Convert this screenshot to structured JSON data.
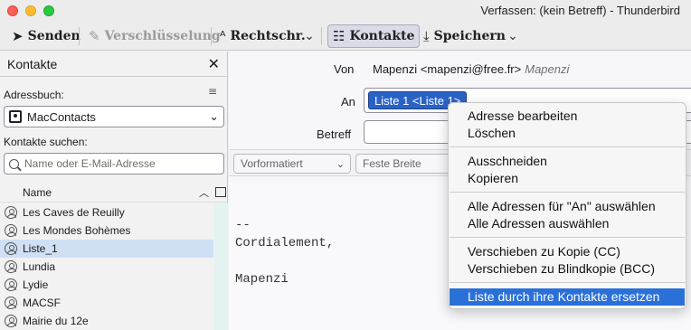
{
  "window": {
    "title": "Verfassen: (kein Betreff) - Thunderbird"
  },
  "toolbar": {
    "send": "Senden",
    "encryption": "Verschlüsselung",
    "spelling": "Rechtschr.",
    "contacts": "Kontakte",
    "save": "Speichern"
  },
  "sidebar": {
    "title": "Kontakte",
    "addressbook_label": "Adressbuch:",
    "addressbook_value": "MacContacts",
    "search_label": "Kontakte suchen:",
    "search_placeholder": "Name oder E-Mail-Adresse",
    "column_name": "Name",
    "contacts": [
      {
        "name": "Les Caves de Reuilly"
      },
      {
        "name": "Les Mondes Bohèmes"
      },
      {
        "name": "Liste_1"
      },
      {
        "name": "Lundia"
      },
      {
        "name": "Lydie"
      },
      {
        "name": "MACSF"
      },
      {
        "name": "Mairie du 12e"
      }
    ]
  },
  "compose": {
    "from_label": "Von",
    "from_value": "Mapenzi <mapenzi@free.fr>",
    "from_identity": "Mapenzi",
    "to_label": "An",
    "to_recipient": "Liste 1 <Liste 1>",
    "subject_label": "Betreff",
    "format_paragraph": "Vorformatiert",
    "format_font": "Feste Breite",
    "signature_lines": [
      "--",
      "Cordialement,",
      "",
      "Mapenzi"
    ]
  },
  "context_menu": {
    "items": [
      "Adresse bearbeiten",
      "Löschen",
      "Ausschneiden",
      "Kopieren",
      "Alle Adressen für \"An\" auswählen",
      "Alle Adressen auswählen",
      "Verschieben zu Kopie (CC)",
      "Verschieben zu Blindkopie (BCC)",
      "Liste durch ihre Kontakte ersetzen"
    ],
    "highlighted_index": 8
  },
  "colors": {
    "accent": "#2a70d9",
    "selection": "#cfe0f5",
    "pill": "#2a63c7"
  }
}
